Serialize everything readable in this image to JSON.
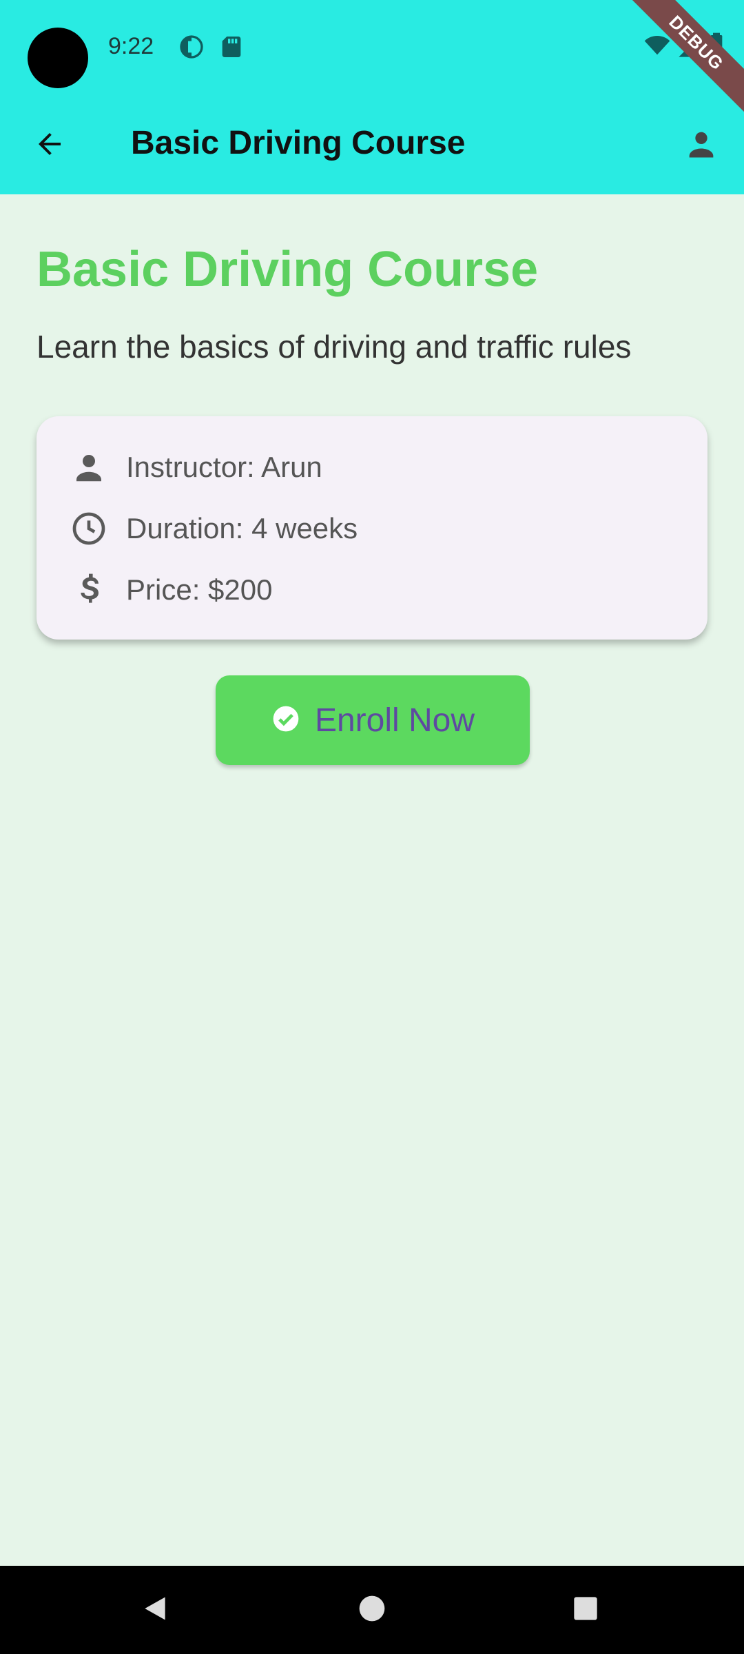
{
  "status_bar": {
    "time": "9:22",
    "debug_label": "DEBUG"
  },
  "app_bar": {
    "title": "Basic Driving Course",
    "back_icon": "arrow-back-icon",
    "profile_icon": "person-icon"
  },
  "course": {
    "heading": "Basic Driving Course",
    "description": "Learn the basics of driving and traffic rules",
    "details": [
      {
        "icon": "person-icon",
        "text": "Instructor: Arun"
      },
      {
        "icon": "clock-icon",
        "text": "Duration: 4 weeks"
      },
      {
        "icon": "dollar-icon",
        "text": "Price: $200"
      }
    ]
  },
  "actions": {
    "enroll_label": "Enroll Now",
    "enroll_icon": "check-circle-icon"
  },
  "colors": {
    "app_bar_bg": "#29ebe2",
    "page_bg": "#e6f5e9",
    "heading_green": "#5cd05f",
    "button_green": "#5cd95f",
    "button_text": "#5e4aa0",
    "card_bg": "#f5f1f8"
  },
  "nav_bar": {
    "back_icon": "triangle-back-icon",
    "home_icon": "circle-home-icon",
    "recents_icon": "square-recents-icon"
  }
}
